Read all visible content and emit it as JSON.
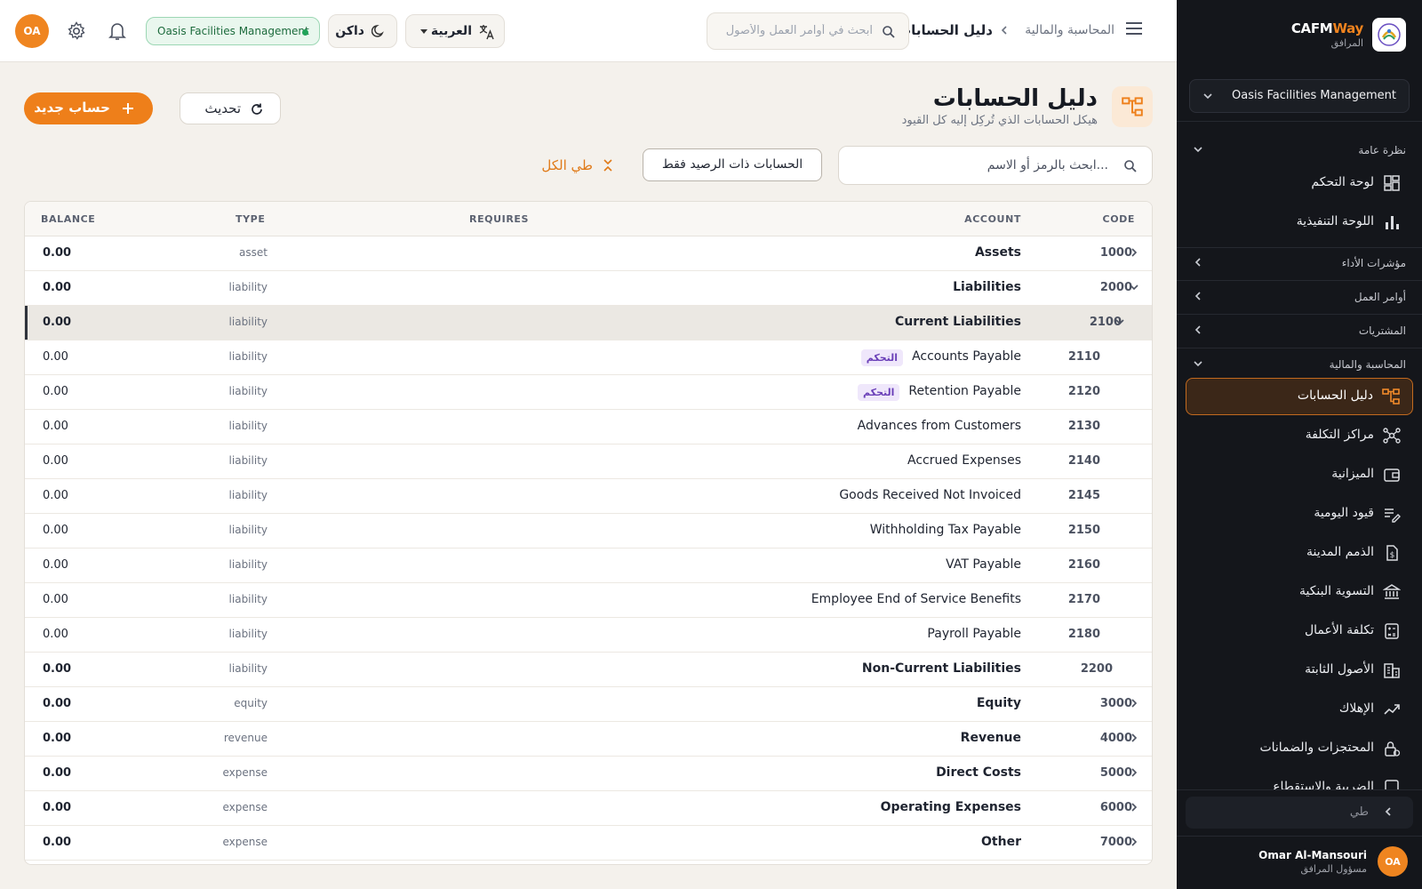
{
  "sidebar": {
    "brand_part1": "CAFM",
    "brand_part2": "Way",
    "brand_sub": "المرافق",
    "org": "Oasis Facilities Management",
    "sections": {
      "overview": "نظرة عامة",
      "kpi": "مؤشرات الأداء",
      "work_orders": "أوامر العمل",
      "procurement": "المشتريات",
      "finance": "المحاسبة والمالية"
    },
    "overview_items": [
      {
        "label": "لوحة التحكم",
        "icon": "dashboard-icon"
      },
      {
        "label": "اللوحة التنفيذية",
        "icon": "bar-chart-icon"
      }
    ],
    "finance_items": [
      {
        "label": "دليل الحسابات",
        "icon": "account-tree-icon"
      },
      {
        "label": "مراكز التكلفة",
        "icon": "hub-icon"
      },
      {
        "label": "الميزانية",
        "icon": "wallet-icon"
      },
      {
        "label": "قيود اليومية",
        "icon": "edit-note-icon"
      },
      {
        "label": "الذمم المدينة",
        "icon": "receipt-icon"
      },
      {
        "label": "التسوية البنكية",
        "icon": "bank-icon"
      },
      {
        "label": "تكلفة الأعمال",
        "icon": "calculator-icon"
      },
      {
        "label": "الأصول الثابتة",
        "icon": "building-icon"
      },
      {
        "label": "الإهلاك",
        "icon": "trend-icon"
      },
      {
        "label": "المحتجزات والضمانات",
        "icon": "lock-icon"
      },
      {
        "label": "الضريبة والاستقطاع",
        "icon": "tax-icon"
      }
    ],
    "collapse_label": "طي",
    "user_name": "Omar Al-Mansouri",
    "user_role": "مسؤول المرافق",
    "user_initials": "OA"
  },
  "topbar": {
    "breadcrumb_parent": "المحاسبة والمالية",
    "breadcrumb_current": "دليل الحسابات",
    "search_placeholder": "ابحث في أوامر العمل والأصول",
    "language": "العربية",
    "theme": "داكن",
    "org_pill": "Oasis Facilities Management",
    "avatar": "OA"
  },
  "page": {
    "title": "دليل الحسابات",
    "subtitle": "هيكل الحسابات الذي تُركِل إليه كل القيود",
    "refresh_label": "تحديث",
    "new_account_label": "حساب جديد",
    "search_placeholder": "ابحث بالرمز أو الاسم...",
    "balance_filter_label": "الحسابات ذات الرصيد فقط",
    "collapse_all_label": "طي الكل"
  },
  "table": {
    "columns": {
      "code": "CODE",
      "account": "ACCOUNT",
      "requires": "REQUIRES",
      "type": "TYPE",
      "balance": "BALANCE"
    },
    "rows": [
      {
        "code": "1000",
        "name": "Assets",
        "type": "asset",
        "balance": "0.00",
        "level": 0,
        "chevron": "right",
        "badge": ""
      },
      {
        "code": "2000",
        "name": "Liabilities",
        "type": "liability",
        "balance": "0.00",
        "level": 0,
        "chevron": "down",
        "badge": ""
      },
      {
        "code": "2100",
        "name": "Current Liabilities",
        "type": "liability",
        "balance": "0.00",
        "level": 1,
        "chevron": "down",
        "badge": "",
        "selected": true
      },
      {
        "code": "2110",
        "name": "Accounts Payable",
        "type": "liability",
        "balance": "0.00",
        "level": 2,
        "chevron": "",
        "badge": "التحكم"
      },
      {
        "code": "2120",
        "name": "Retention Payable",
        "type": "liability",
        "balance": "0.00",
        "level": 2,
        "chevron": "",
        "badge": "التحكم"
      },
      {
        "code": "2130",
        "name": "Advances from Customers",
        "type": "liability",
        "balance": "0.00",
        "level": 2,
        "chevron": "",
        "badge": ""
      },
      {
        "code": "2140",
        "name": "Accrued Expenses",
        "type": "liability",
        "balance": "0.00",
        "level": 2,
        "chevron": "",
        "badge": ""
      },
      {
        "code": "2145",
        "name": "Goods Received Not Invoiced",
        "type": "liability",
        "balance": "0.00",
        "level": 2,
        "chevron": "",
        "badge": ""
      },
      {
        "code": "2150",
        "name": "Withholding Tax Payable",
        "type": "liability",
        "balance": "0.00",
        "level": 2,
        "chevron": "",
        "badge": ""
      },
      {
        "code": "2160",
        "name": "VAT Payable",
        "type": "liability",
        "balance": "0.00",
        "level": 2,
        "chevron": "",
        "badge": ""
      },
      {
        "code": "2170",
        "name": "Employee End of Service Benefits",
        "type": "liability",
        "balance": "0.00",
        "level": 2,
        "chevron": "",
        "badge": ""
      },
      {
        "code": "2180",
        "name": "Payroll Payable",
        "type": "liability",
        "balance": "0.00",
        "level": 2,
        "chevron": "",
        "badge": ""
      },
      {
        "code": "2200",
        "name": "Non-Current Liabilities",
        "type": "liability",
        "balance": "0.00",
        "level": 1,
        "chevron": "",
        "badge": ""
      },
      {
        "code": "3000",
        "name": "Equity",
        "type": "equity",
        "balance": "0.00",
        "level": 0,
        "chevron": "right",
        "badge": ""
      },
      {
        "code": "4000",
        "name": "Revenue",
        "type": "revenue",
        "balance": "0.00",
        "level": 0,
        "chevron": "right",
        "badge": ""
      },
      {
        "code": "5000",
        "name": "Direct Costs",
        "type": "expense",
        "balance": "0.00",
        "level": 0,
        "chevron": "right",
        "badge": ""
      },
      {
        "code": "6000",
        "name": "Operating Expenses",
        "type": "expense",
        "balance": "0.00",
        "level": 0,
        "chevron": "right",
        "badge": ""
      },
      {
        "code": "7000",
        "name": "Other",
        "type": "expense",
        "balance": "0.00",
        "level": 0,
        "chevron": "right",
        "badge": ""
      }
    ]
  },
  "colors": {
    "accent": "#ee7f1a",
    "sidebar_bg": "#14161b",
    "badge_bg": "#efe7fb",
    "badge_text": "#6a3fb8"
  }
}
